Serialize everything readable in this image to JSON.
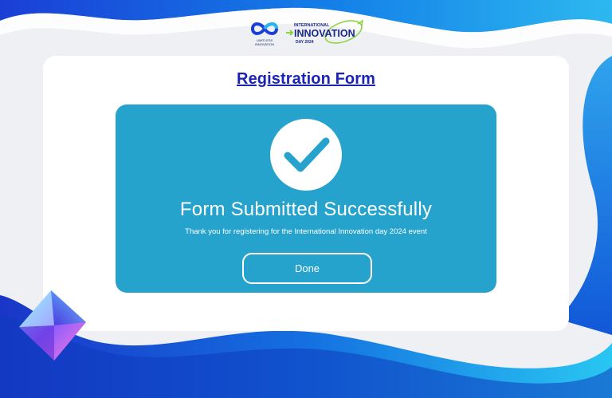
{
  "logos": {
    "brand_line1": "LIMITLESS",
    "brand_line2": "INNOVATION",
    "event_top": "INTERNATIONAL",
    "event_main": "INNOVATION",
    "event_bottom": "DAY 2024"
  },
  "form": {
    "title": "Registration Form"
  },
  "success": {
    "title": "Form Submitted Successfully",
    "message": "Thank you for registering for the International Innovation day 2024 event",
    "done_label": "Done"
  },
  "colors": {
    "panel": "#26a3cd",
    "title_link": "#1b23b6",
    "background_blue": "#1565e0",
    "card": "#ffffff"
  },
  "icons": [
    "infinity-logo-icon",
    "checkmark-icon",
    "crystal-decoration-icon"
  ]
}
